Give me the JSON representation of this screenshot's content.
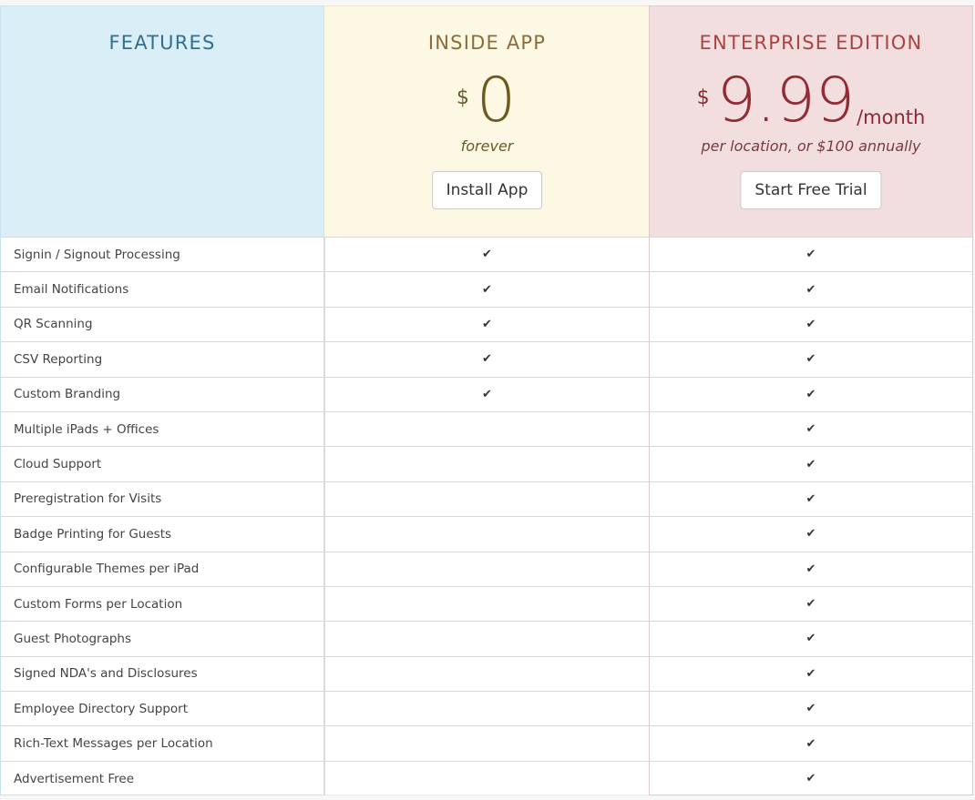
{
  "features_column": {
    "title": "FEATURES",
    "items": [
      "Signin / Signout Processing",
      "Email Notifications",
      "QR Scanning",
      "CSV Reporting",
      "Custom Branding",
      "Multiple iPads + Offices",
      "Cloud Support",
      "Preregistration for Visits",
      "Badge Printing for Guests",
      "Configurable Themes per iPad",
      "Custom Forms per Location",
      "Guest Photographs",
      "Signed NDA's and Disclosures",
      "Employee Directory Support",
      "Rich-Text Messages per Location",
      "Advertisement Free"
    ]
  },
  "plans": {
    "inside_app": {
      "title": "INSIDE APP",
      "currency": "$",
      "amount": "0",
      "unit": "",
      "note": "forever",
      "cta_label": "Install App",
      "included": [
        true,
        true,
        true,
        true,
        true,
        false,
        false,
        false,
        false,
        false,
        false,
        false,
        false,
        false,
        false,
        false
      ]
    },
    "enterprise": {
      "title": "ENTERPRISE EDITION",
      "currency": "$",
      "amount": "9.99",
      "unit": "/month",
      "note": "per location, or $100 annually",
      "cta_label": "Start Free Trial",
      "included": [
        true,
        true,
        true,
        true,
        true,
        true,
        true,
        true,
        true,
        true,
        true,
        true,
        true,
        true,
        true,
        true
      ]
    }
  },
  "icons": {
    "check": "check-icon"
  },
  "colors": {
    "features_header_bg": "#d9eef7",
    "inside_header_bg": "#fdf8e4",
    "enterprise_header_bg": "#f2dede",
    "features_title": "#31708f",
    "inside_title": "#8a6d3b",
    "enterprise_title": "#a94442"
  }
}
